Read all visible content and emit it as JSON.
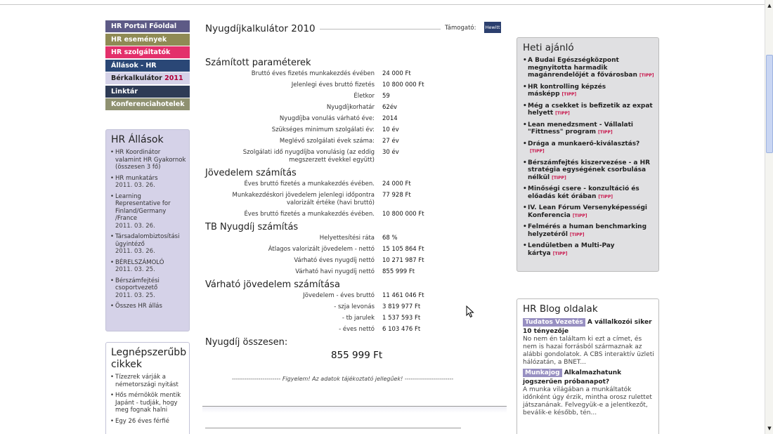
{
  "nav": {
    "items": [
      {
        "label": "HR Portal Főoldal",
        "color": "#5d5a86"
      },
      {
        "label": "HR események",
        "color": "#8f8a54"
      },
      {
        "label": "HR szolgáltatók",
        "color": "#e3306b"
      },
      {
        "label": "Állások - HR",
        "color": "#2a4776"
      },
      {
        "label": "Bérkalkulátor",
        "highlight": "2011",
        "color": "#d5d2e8"
      },
      {
        "label": "Linktár",
        "color": "#2e3b55"
      },
      {
        "label": "Konferenciahotelek",
        "color": "#8f9171"
      }
    ]
  },
  "hr_allasok": {
    "title": "HR Állások",
    "items": [
      {
        "text": "HR Koordinátor valamint HR Gyakornok (összesen 3 fő)",
        "date": ""
      },
      {
        "text": "HR munkatárs",
        "date": "2011. 03. 26."
      },
      {
        "text": "Learning Representative for Finland/Germany /France",
        "date": "2011. 03. 26."
      },
      {
        "text": "Társadalombiztosítási ügyintéző",
        "date": "2011. 03. 26."
      },
      {
        "text": "BÉRELSZÁMOLÓ",
        "date": "2011. 03. 25."
      },
      {
        "text": "Bérszámfejtési csoportvezető",
        "date": "2011. 03. 25."
      },
      {
        "text": "Összes HR állás",
        "date": ""
      }
    ]
  },
  "nepszeru": {
    "title": "Legnépszerűbb cikkek",
    "items": [
      "Tízezrek várják a németországi nyitást",
      "Hős mérnökök mentik Japánt - tudják, hogy meg fognak halni",
      "Egy 26 éves férfié"
    ]
  },
  "calc": {
    "title": "Nyugdíjkalkulátor 2010",
    "sponsor_label": "Támogató:",
    "sponsor_logo": "Hewitt",
    "sections": [
      {
        "title": "Számított paraméterek",
        "rows": [
          {
            "label": "Bruttó éves fizetés munkakezdés évében",
            "value": "24 000 Ft"
          },
          {
            "label": "Jelenlegi éves bruttó fizetés",
            "value": "10 800 000 Ft"
          },
          {
            "label": "Életkor",
            "value": "59"
          },
          {
            "label": "Nyugdíjkorhatár",
            "value": "62év"
          },
          {
            "label": "Nyugdíjba vonulás várható éve:",
            "value": "2014"
          },
          {
            "label": "Szükséges minimum szolgálati év:",
            "value": "10 év"
          },
          {
            "label": "Meglévő szolgálati évek száma:",
            "value": "27 év"
          },
          {
            "label": "Szolgálati idő nyugdíjba vonulásig (az eddig megszerzett évekkel együtt)",
            "value": "30 év"
          }
        ]
      },
      {
        "title": "Jövedelem számítás",
        "rows": [
          {
            "label": "Éves bruttó fizetés a munkakezdés évében.",
            "value": "24 000 Ft"
          },
          {
            "label": "Munkakezdéskori jövedelem jelenlegi időpontra valorizált értéke (havi bruttó)",
            "value": "77 928 Ft"
          },
          {
            "label": "Éves bruttó fizetés a munkakezdés évében.",
            "value": "10 800 000 Ft"
          }
        ]
      },
      {
        "title": "TB Nyugdíj számítás",
        "rows": [
          {
            "label": "Helyettesítési ráta",
            "value": "68 %"
          },
          {
            "label": "Átlagos valorizált jövedelem - nettó",
            "value": "15 105 864 Ft"
          },
          {
            "label": "Várható éves nyugdíj nettó",
            "value": "10 271 987 Ft"
          },
          {
            "label": "Várható havi nyugdíj nettó",
            "value": "855 999 Ft"
          }
        ]
      },
      {
        "title": "Várható jövedelem számítása",
        "rows": [
          {
            "label": "Jövedelem - éves bruttó",
            "value": "11 461 046 Ft"
          },
          {
            "label": "- szja levonás",
            "value": "3 819 977 Ft"
          },
          {
            "label": "- tb jarulek",
            "value": "1 537 593 Ft"
          },
          {
            "label": "- éves nettó",
            "value": "6 103 476 Ft"
          }
        ]
      }
    ],
    "total_title": "Nyugdíj összesen:",
    "total_value": "855 999 Ft",
    "notice": "------------------------ Figyelem! Az adatok tájékoztató jellegűek! ------------------------"
  },
  "heti": {
    "title": "Heti ajánló",
    "tipp_label": "[TIPP]",
    "items": [
      "A Budai Egészségközpont megnyitotta harmadik magánrendelőjét a fővárosban",
      "HR kontrolling képzés másképp",
      "Még a csekket is befizetik az expat helyett",
      "Lean menedzsment - Vállalati \"Fittness\" program",
      "Drága a munkaerő-kiválasztás?",
      "Bérszámfejtés kiszervezése - a HR stratégia egységének csorbulása nélkül",
      "Minőségi csere - konzultáció és előadás két órában",
      "IV. Lean Fórum Versenyképességi Konferencia",
      "Felmérés a human benchmarking helyzetéről",
      "Lendületben a Multi-Pay kártya"
    ]
  },
  "blog": {
    "title": "HR Blog oldalak",
    "entries": [
      {
        "tag": "Tudatos Vezetés",
        "head": "A vállalkozói siker 10 tényezője",
        "text": "No nem én találtam ki ezt a címet, és nem is hazai forrásból származnak az alábbi gondolatok. A CBS interaktív üzleti hálózatán, a BNET..."
      },
      {
        "tag": "Munkajog",
        "head": "Alkalmazhatunk jogszerűen próbanapot?",
        "text": "A munka világában a munkáltatók időnként úgy érzik, mintha orosz rulettet játszanának. Felvegyük-e a jelentkezőt, beválik-e később, tén..."
      }
    ]
  }
}
